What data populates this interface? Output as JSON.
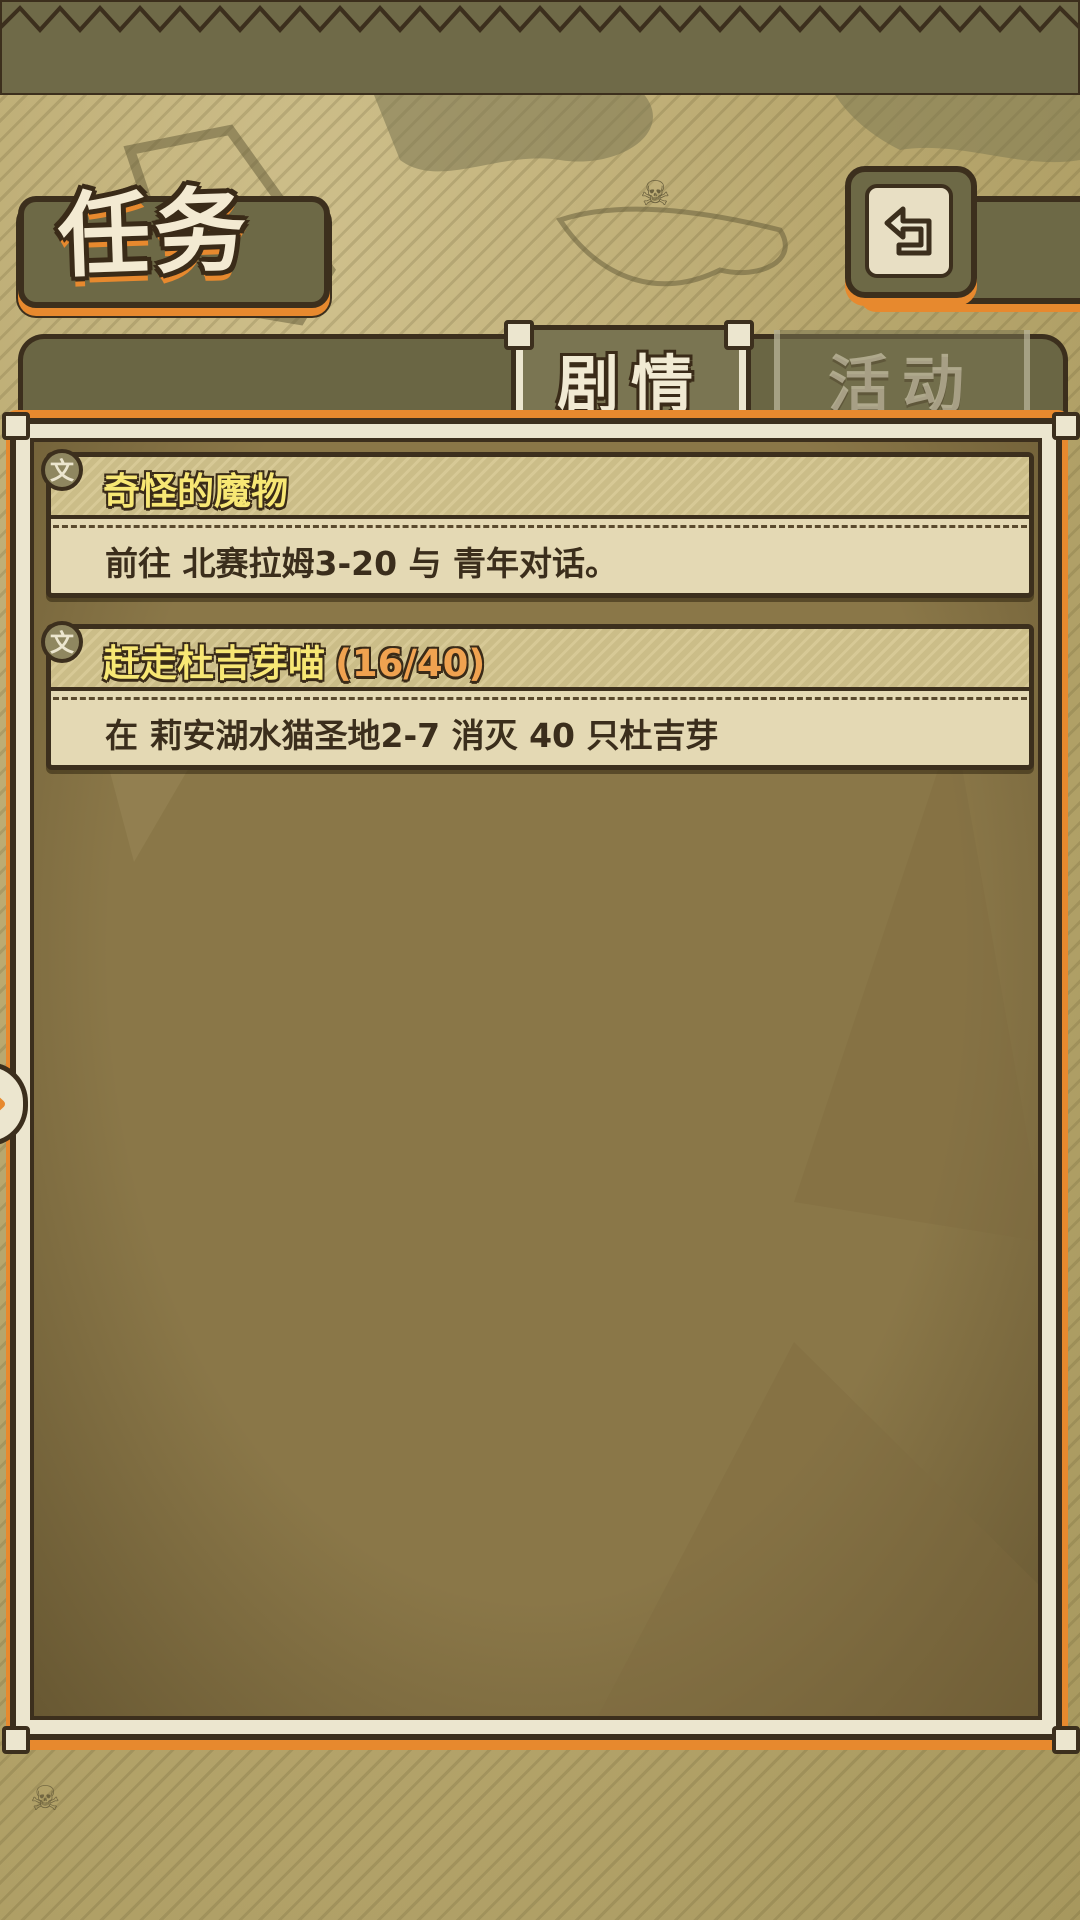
{
  "header": {
    "title": "任务",
    "back_icon": "return-arrow-icon"
  },
  "tabs": [
    {
      "label": "剧情",
      "active": true
    },
    {
      "label": "活动",
      "active": false
    }
  ],
  "quests": [
    {
      "icon": "scroll-icon",
      "title": "奇怪的魔物",
      "progress": "",
      "description": "前往 北赛拉姆3-20 与 青年对话。"
    },
    {
      "icon": "scroll-icon",
      "title": "赶走杜吉芽喵",
      "progress": "(16/40)",
      "description": "在 莉安湖水猫圣地2-7 消灭 40 只杜吉芽"
    }
  ],
  "colors": {
    "accent_orange": "#e7892e",
    "frame_dark": "#3c2f1d",
    "title_yellow": "#f7e774",
    "progress_orange": "#f0a250",
    "panel_brown": "#8a7748"
  }
}
